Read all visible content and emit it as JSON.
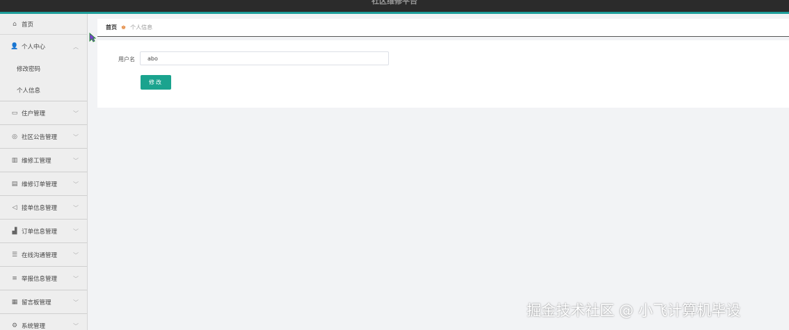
{
  "header": {
    "title": "社区维修平台"
  },
  "sidebar": {
    "items": [
      {
        "label": "首页",
        "icon": "home-icon"
      },
      {
        "label": "个人中心",
        "icon": "user-icon",
        "children": [
          "修改密码",
          "个人信息"
        ]
      },
      {
        "label": "住户管理",
        "icon": "monitor-icon"
      },
      {
        "label": "社区公告管理",
        "icon": "circle-icon"
      },
      {
        "label": "维修工管理",
        "icon": "bar-chart-icon"
      },
      {
        "label": "维修订单管理",
        "icon": "document-icon"
      },
      {
        "label": "接单信息管理",
        "icon": "send-icon"
      },
      {
        "label": "订单信息管理",
        "icon": "column-chart-icon"
      },
      {
        "label": "在线沟通管理",
        "icon": "filter-icon"
      },
      {
        "label": "举报信息管理",
        "icon": "list-icon"
      },
      {
        "label": "留言板管理",
        "icon": "grid-icon"
      },
      {
        "label": "系统管理",
        "icon": "settings-icon"
      }
    ]
  },
  "breadcrumb": {
    "home": "首页",
    "current": "个人信息"
  },
  "form": {
    "username_label": "用户名",
    "username_value": "abo",
    "submit_label": "修改"
  },
  "watermark": "掘金技术社区 @ 小飞计算机毕设",
  "colors": {
    "topbar": "#2b2b2b",
    "accent": "#1e9e9a",
    "button": "#1aa38e"
  }
}
